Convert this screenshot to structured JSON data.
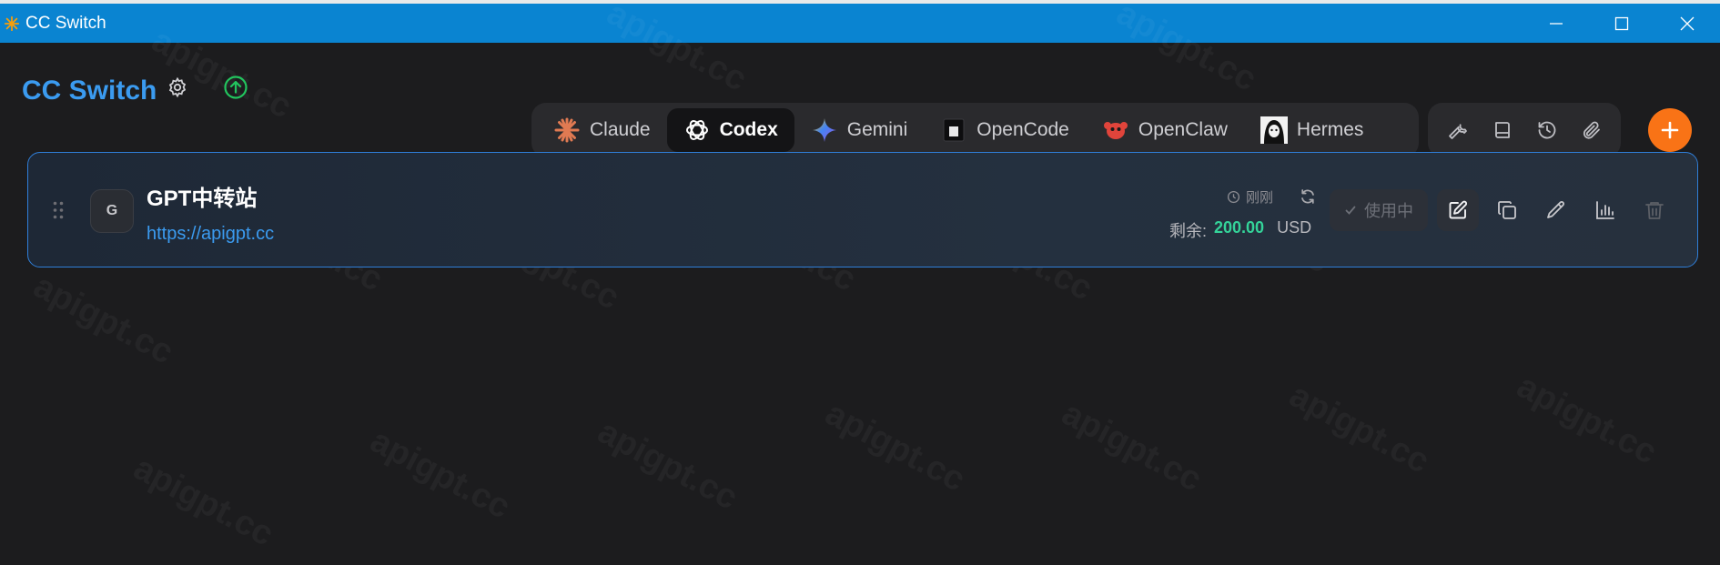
{
  "window": {
    "title": "CC Switch"
  },
  "header": {
    "brand": "CC Switch"
  },
  "tabs": [
    {
      "label": "Claude",
      "icon": "claude-icon"
    },
    {
      "label": "Codex",
      "icon": "codex-icon",
      "active": true
    },
    {
      "label": "Gemini",
      "icon": "gemini-icon"
    },
    {
      "label": "OpenCode",
      "icon": "opencode-icon"
    },
    {
      "label": "OpenClaw",
      "icon": "openclaw-icon"
    },
    {
      "label": "Hermes",
      "icon": "hermes-icon"
    }
  ],
  "tools": [
    "wrench-icon",
    "book-icon",
    "history-icon",
    "paperclip-icon"
  ],
  "provider": {
    "initial": "G",
    "name": "GPT中转站",
    "url": "https://apigpt.cc",
    "usage_time": "刚刚",
    "remain_label": "剩余:",
    "remain_value": "200.00",
    "remain_unit": "USD",
    "status_label": "使用中"
  },
  "watermark": "apigpt.cc",
  "colors": {
    "accent": "#3b9bf0",
    "titlebar": "#0a84d1",
    "add_button": "#f97316",
    "balance": "#34d399"
  }
}
